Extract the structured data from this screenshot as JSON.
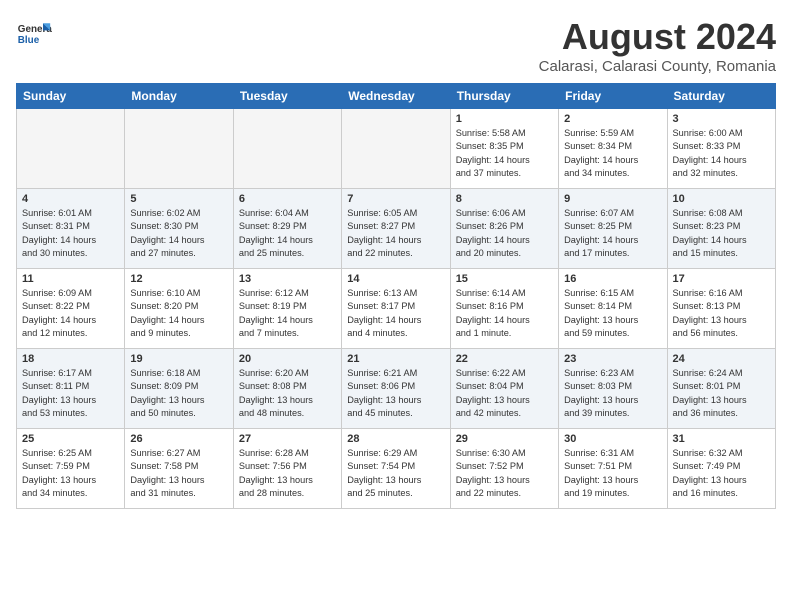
{
  "header": {
    "logo_general": "General",
    "logo_blue": "Blue",
    "month_title": "August 2024",
    "location": "Calarasi, Calarasi County, Romania"
  },
  "days_of_week": [
    "Sunday",
    "Monday",
    "Tuesday",
    "Wednesday",
    "Thursday",
    "Friday",
    "Saturday"
  ],
  "weeks": [
    [
      {
        "num": "",
        "info": ""
      },
      {
        "num": "",
        "info": ""
      },
      {
        "num": "",
        "info": ""
      },
      {
        "num": "",
        "info": ""
      },
      {
        "num": "1",
        "info": "Sunrise: 5:58 AM\nSunset: 8:35 PM\nDaylight: 14 hours\nand 37 minutes."
      },
      {
        "num": "2",
        "info": "Sunrise: 5:59 AM\nSunset: 8:34 PM\nDaylight: 14 hours\nand 34 minutes."
      },
      {
        "num": "3",
        "info": "Sunrise: 6:00 AM\nSunset: 8:33 PM\nDaylight: 14 hours\nand 32 minutes."
      }
    ],
    [
      {
        "num": "4",
        "info": "Sunrise: 6:01 AM\nSunset: 8:31 PM\nDaylight: 14 hours\nand 30 minutes."
      },
      {
        "num": "5",
        "info": "Sunrise: 6:02 AM\nSunset: 8:30 PM\nDaylight: 14 hours\nand 27 minutes."
      },
      {
        "num": "6",
        "info": "Sunrise: 6:04 AM\nSunset: 8:29 PM\nDaylight: 14 hours\nand 25 minutes."
      },
      {
        "num": "7",
        "info": "Sunrise: 6:05 AM\nSunset: 8:27 PM\nDaylight: 14 hours\nand 22 minutes."
      },
      {
        "num": "8",
        "info": "Sunrise: 6:06 AM\nSunset: 8:26 PM\nDaylight: 14 hours\nand 20 minutes."
      },
      {
        "num": "9",
        "info": "Sunrise: 6:07 AM\nSunset: 8:25 PM\nDaylight: 14 hours\nand 17 minutes."
      },
      {
        "num": "10",
        "info": "Sunrise: 6:08 AM\nSunset: 8:23 PM\nDaylight: 14 hours\nand 15 minutes."
      }
    ],
    [
      {
        "num": "11",
        "info": "Sunrise: 6:09 AM\nSunset: 8:22 PM\nDaylight: 14 hours\nand 12 minutes."
      },
      {
        "num": "12",
        "info": "Sunrise: 6:10 AM\nSunset: 8:20 PM\nDaylight: 14 hours\nand 9 minutes."
      },
      {
        "num": "13",
        "info": "Sunrise: 6:12 AM\nSunset: 8:19 PM\nDaylight: 14 hours\nand 7 minutes."
      },
      {
        "num": "14",
        "info": "Sunrise: 6:13 AM\nSunset: 8:17 PM\nDaylight: 14 hours\nand 4 minutes."
      },
      {
        "num": "15",
        "info": "Sunrise: 6:14 AM\nSunset: 8:16 PM\nDaylight: 14 hours\nand 1 minute."
      },
      {
        "num": "16",
        "info": "Sunrise: 6:15 AM\nSunset: 8:14 PM\nDaylight: 13 hours\nand 59 minutes."
      },
      {
        "num": "17",
        "info": "Sunrise: 6:16 AM\nSunset: 8:13 PM\nDaylight: 13 hours\nand 56 minutes."
      }
    ],
    [
      {
        "num": "18",
        "info": "Sunrise: 6:17 AM\nSunset: 8:11 PM\nDaylight: 13 hours\nand 53 minutes."
      },
      {
        "num": "19",
        "info": "Sunrise: 6:18 AM\nSunset: 8:09 PM\nDaylight: 13 hours\nand 50 minutes."
      },
      {
        "num": "20",
        "info": "Sunrise: 6:20 AM\nSunset: 8:08 PM\nDaylight: 13 hours\nand 48 minutes."
      },
      {
        "num": "21",
        "info": "Sunrise: 6:21 AM\nSunset: 8:06 PM\nDaylight: 13 hours\nand 45 minutes."
      },
      {
        "num": "22",
        "info": "Sunrise: 6:22 AM\nSunset: 8:04 PM\nDaylight: 13 hours\nand 42 minutes."
      },
      {
        "num": "23",
        "info": "Sunrise: 6:23 AM\nSunset: 8:03 PM\nDaylight: 13 hours\nand 39 minutes."
      },
      {
        "num": "24",
        "info": "Sunrise: 6:24 AM\nSunset: 8:01 PM\nDaylight: 13 hours\nand 36 minutes."
      }
    ],
    [
      {
        "num": "25",
        "info": "Sunrise: 6:25 AM\nSunset: 7:59 PM\nDaylight: 13 hours\nand 34 minutes."
      },
      {
        "num": "26",
        "info": "Sunrise: 6:27 AM\nSunset: 7:58 PM\nDaylight: 13 hours\nand 31 minutes."
      },
      {
        "num": "27",
        "info": "Sunrise: 6:28 AM\nSunset: 7:56 PM\nDaylight: 13 hours\nand 28 minutes."
      },
      {
        "num": "28",
        "info": "Sunrise: 6:29 AM\nSunset: 7:54 PM\nDaylight: 13 hours\nand 25 minutes."
      },
      {
        "num": "29",
        "info": "Sunrise: 6:30 AM\nSunset: 7:52 PM\nDaylight: 13 hours\nand 22 minutes."
      },
      {
        "num": "30",
        "info": "Sunrise: 6:31 AM\nSunset: 7:51 PM\nDaylight: 13 hours\nand 19 minutes."
      },
      {
        "num": "31",
        "info": "Sunrise: 6:32 AM\nSunset: 7:49 PM\nDaylight: 13 hours\nand 16 minutes."
      }
    ]
  ]
}
